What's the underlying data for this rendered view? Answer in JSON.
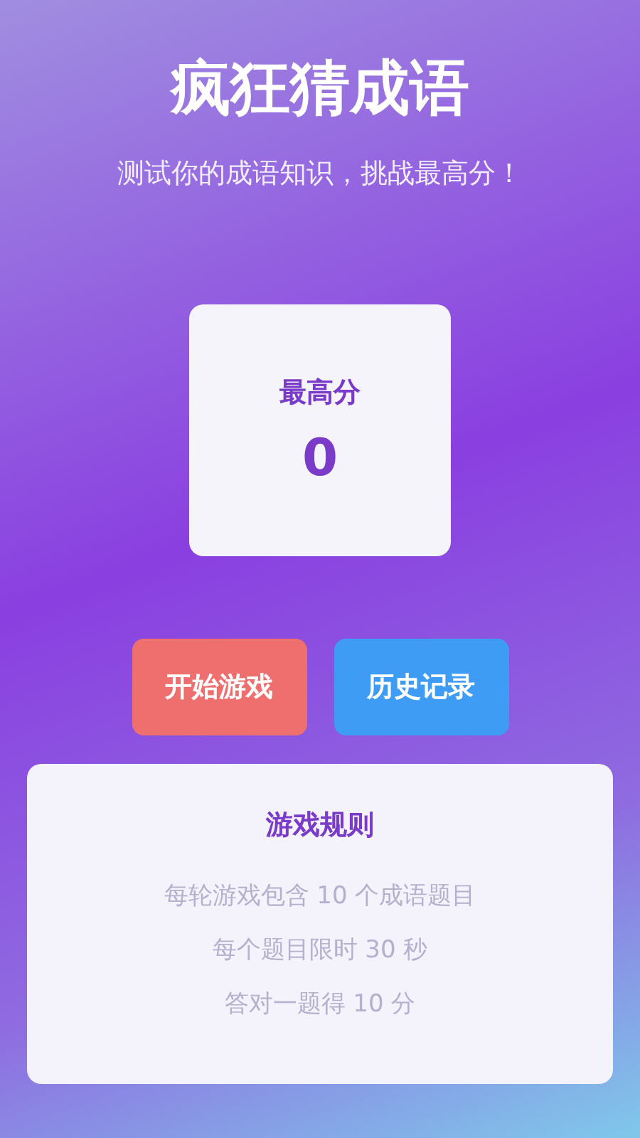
{
  "title": "疯狂猜成语",
  "subtitle": "测试你的成语知识，挑战最高分！",
  "score_card": {
    "label": "最高分",
    "value": "0"
  },
  "buttons": [
    {
      "label": "开始游戏",
      "kind": "primary"
    },
    {
      "label": "历史记录",
      "kind": "secondary"
    }
  ],
  "rules": {
    "title": "游戏规则",
    "items": [
      "每轮游戏包含 10 个成语题目",
      "每个题目限时 30 秒",
      "答对一题得 10 分"
    ]
  }
}
